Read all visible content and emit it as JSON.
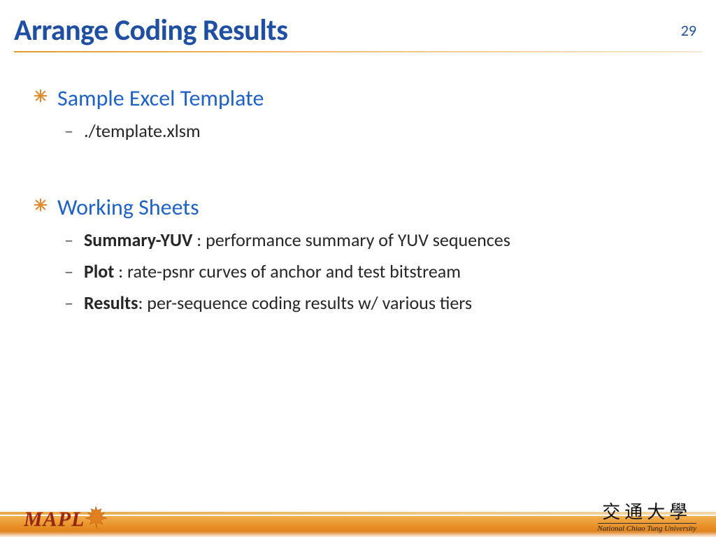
{
  "header": {
    "title": "Arrange Coding Results",
    "page_number": "29"
  },
  "body": {
    "sections": [
      {
        "heading": "Sample Excel Template",
        "items": [
          {
            "text": "./template.xlsm"
          }
        ]
      },
      {
        "heading": "Working Sheets",
        "items": [
          {
            "bold": "Summary-YUV",
            "sep": " : ",
            "rest": "performance summary of YUV sequences"
          },
          {
            "bold": "Plot",
            "sep": " : ",
            "rest": "rate-psnr curves of anchor and test bitstream"
          },
          {
            "bold": "Results",
            "sep": ": ",
            "rest": "per-sequence coding results w/ various tiers"
          }
        ]
      }
    ]
  },
  "footer": {
    "left_logo_text": "MAPL",
    "right_logo_cn": "交通大學",
    "right_logo_en": "National Chiao Tung University"
  },
  "icons": {
    "bullet": "asterisk-icon",
    "leaf": "maple-leaf-icon"
  }
}
